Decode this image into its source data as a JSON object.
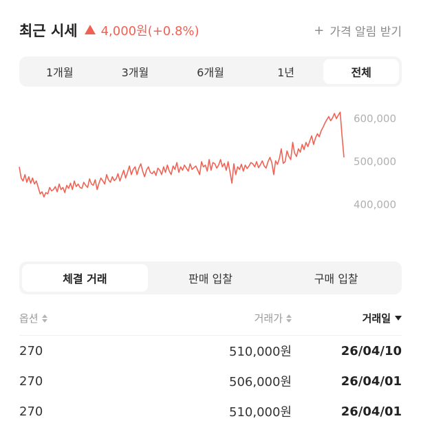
{
  "header": {
    "title": "최근 시세",
    "change": "4,000원(+0.8%)",
    "alert_label": "가격 알림 받기",
    "accent_color": "#ef6253"
  },
  "period_tabs": [
    {
      "label": "1개월",
      "active": false
    },
    {
      "label": "3개월",
      "active": false
    },
    {
      "label": "6개월",
      "active": false
    },
    {
      "label": "1년",
      "active": false
    },
    {
      "label": "전체",
      "active": true
    }
  ],
  "chart_data": {
    "type": "line",
    "title": "",
    "xlabel": "",
    "ylabel": "",
    "y_ticks": [
      "600,000",
      "500,000",
      "400,000"
    ],
    "ylim": [
      380000,
      620000
    ],
    "grid": false,
    "series": [
      {
        "color": "#ef6253",
        "values": [
          488000,
          462000,
          455000,
          470000,
          452000,
          465000,
          450000,
          462000,
          448000,
          455000,
          440000,
          425000,
          430000,
          418000,
          428000,
          425000,
          440000,
          432000,
          435000,
          442000,
          430000,
          448000,
          435000,
          440000,
          428000,
          445000,
          438000,
          450000,
          435000,
          455000,
          442000,
          448000,
          440000,
          438000,
          452000,
          445000,
          440000,
          460000,
          448000,
          445000,
          458000,
          435000,
          450000,
          462000,
          455000,
          448000,
          470000,
          458000,
          452000,
          465000,
          456000,
          460000,
          472000,
          455000,
          468000,
          480000,
          462000,
          475000,
          490000,
          470000,
          482000,
          488000,
          470000,
          485000,
          495000,
          478000,
          465000,
          480000,
          488000,
          475000,
          472000,
          478000,
          468000,
          485000,
          480000,
          470000,
          488000,
          475000,
          492000,
          478000,
          470000,
          490000,
          482000,
          498000,
          475000,
          488000,
          480000,
          492000,
          485000,
          478000,
          495000,
          482000,
          486000,
          490000,
          480000,
          470000,
          500000,
          488000,
          492000,
          478000,
          505000,
          480000,
          498000,
          495000,
          485000,
          492000,
          505000,
          488000,
          496000,
          480000,
          500000,
          475000,
          450000,
          495000,
          470000,
          488000,
          482000,
          494000,
          478000,
          492000,
          484000,
          490000,
          498000,
          495000,
          488000,
          500000,
          486000,
          493000,
          502000,
          490000,
          485000,
          500000,
          510000,
          498000,
          470000,
          502000,
          494000,
          508000,
          530000,
          496000,
          500000,
          525000,
          512000,
          505000,
          545000,
          520000,
          512000,
          530000,
          522000,
          540000,
          528000,
          545000,
          535000,
          548000,
          560000,
          540000,
          555000,
          565000,
          558000,
          572000,
          580000,
          590000,
          598000,
          605000,
          595000,
          602000,
          612000,
          600000,
          608000,
          615000,
          560000,
          510000
        ]
      }
    ]
  },
  "trade_tabs": [
    {
      "label": "체결 거래",
      "active": true
    },
    {
      "label": "판매 입찰",
      "active": false
    },
    {
      "label": "구매 입찰",
      "active": false
    }
  ],
  "table": {
    "headers": [
      "옵션",
      "거래가",
      "거래일"
    ],
    "rows": [
      {
        "option": "270",
        "price": "510,000원",
        "date": "26/04/10"
      },
      {
        "option": "270",
        "price": "506,000원",
        "date": "26/04/01"
      },
      {
        "option": "270",
        "price": "510,000원",
        "date": "26/04/01"
      }
    ]
  }
}
